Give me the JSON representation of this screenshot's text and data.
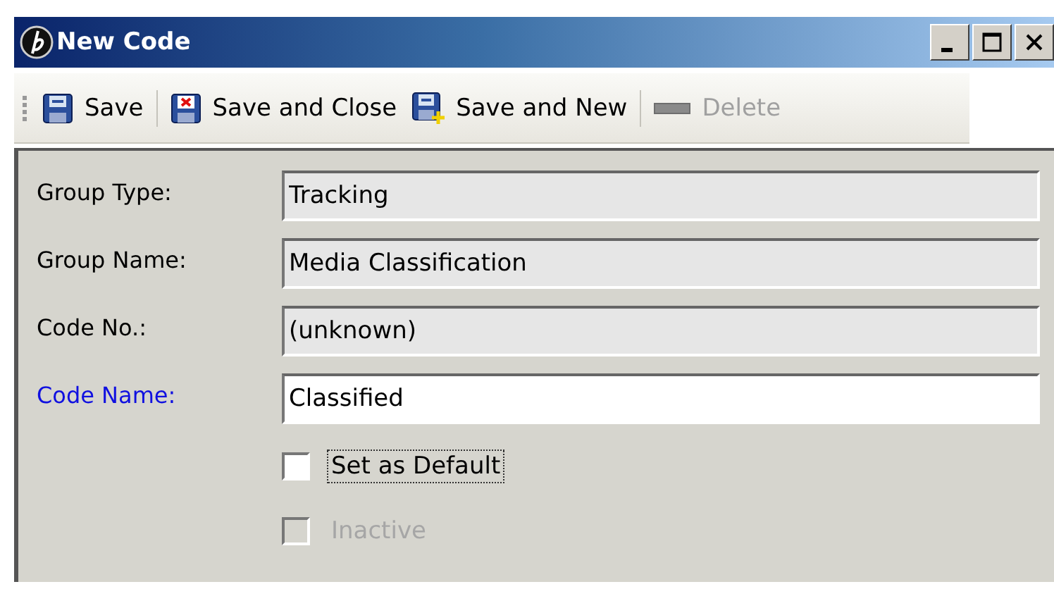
{
  "window": {
    "title": "New Code"
  },
  "toolbar": [
    {
      "kind": "button",
      "label": "Save",
      "disabled": false
    },
    {
      "kind": "separator"
    },
    {
      "kind": "button",
      "label": "Save and Close",
      "disabled": false
    },
    {
      "kind": "button",
      "label": "Save and New",
      "disabled": false
    },
    {
      "kind": "separator"
    },
    {
      "kind": "button",
      "label": "Delete",
      "disabled": true
    }
  ],
  "fields": [
    {
      "label": "Group Type:",
      "value": "Tracking",
      "readonly": true,
      "required": false
    },
    {
      "label": "Group Name:",
      "value": "Media Classification",
      "readonly": true,
      "required": false
    },
    {
      "label": "Code No.:",
      "value": "(unknown)",
      "readonly": true,
      "required": false
    },
    {
      "label": "Code Name:",
      "value": "Classified",
      "readonly": false,
      "required": true
    }
  ],
  "checkboxes": [
    {
      "label": "Set as Default",
      "checked": false,
      "disabled": false,
      "focused": true
    },
    {
      "label": "Inactive",
      "checked": false,
      "disabled": true,
      "focused": false
    }
  ]
}
